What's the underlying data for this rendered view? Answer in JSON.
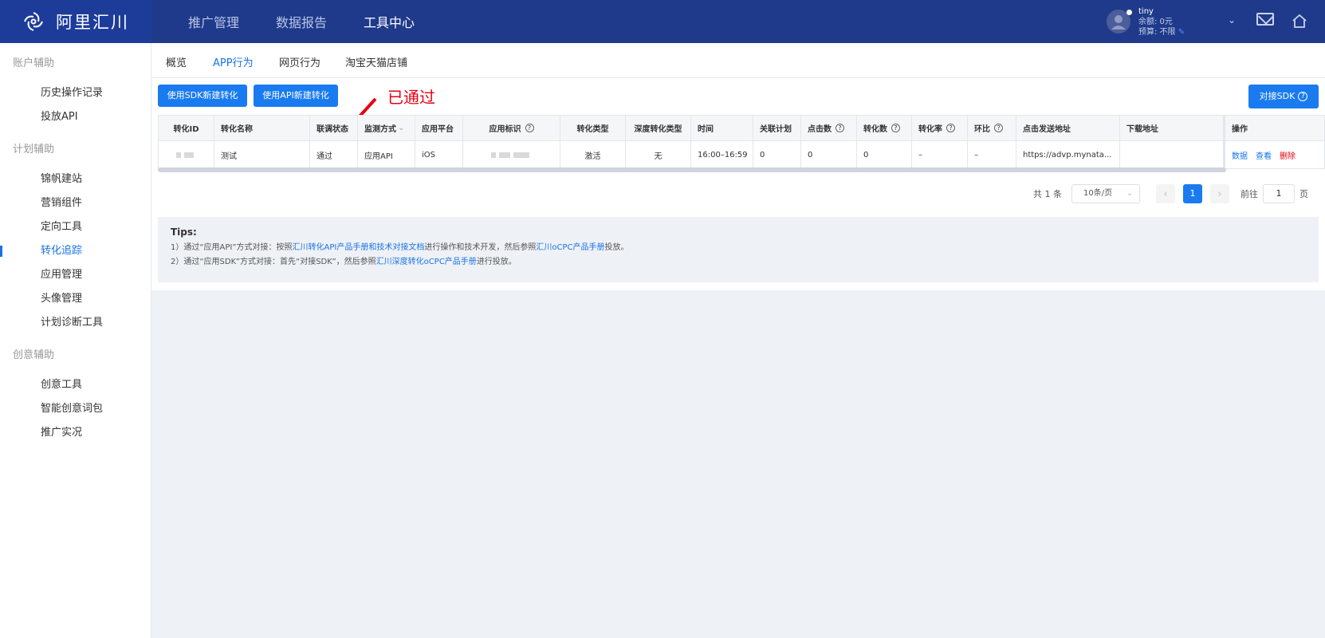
{
  "app": {
    "brand": "阿里汇川"
  },
  "topnav": [
    {
      "label": "推广管理",
      "active": false
    },
    {
      "label": "数据报告",
      "active": false
    },
    {
      "label": "工具中心",
      "active": true
    }
  ],
  "user": {
    "name": "tiny",
    "balance": "余额: 0元",
    "budget": "预算: 不限"
  },
  "sidebar": {
    "groups": [
      {
        "title": "账户辅助",
        "items": [
          "历史操作记录",
          "投放API"
        ]
      },
      {
        "title": "计划辅助",
        "items": [
          "锦帆建站",
          "营销组件",
          "定向工具",
          "转化追踪",
          "应用管理",
          "头像管理",
          "计划诊断工具"
        ]
      },
      {
        "title": "创意辅助",
        "items": [
          "创意工具",
          "智能创意词包",
          "推广实况"
        ]
      }
    ],
    "active": "转化追踪"
  },
  "tabs": [
    "概览",
    "APP行为",
    "网页行为",
    "淘宝天猫店铺"
  ],
  "buttons": {
    "sdk_new": "使用SDK新建转化",
    "api_new": "使用API新建转化",
    "connect_sdk": "对接SDK"
  },
  "annotation": "已通过",
  "table": {
    "headers": [
      "转化ID",
      "转化名称",
      "联调状态",
      "监测方式",
      "应用平台",
      "应用标识",
      "转化类型",
      "深度转化类型",
      "时间",
      "关联计划",
      "点击数",
      "转化数",
      "转化率",
      "环比",
      "点击发送地址",
      "下载地址",
      "操作"
    ],
    "row": {
      "name": "测试",
      "status": "通过",
      "monitor": "应用API",
      "platform": "iOS",
      "conv_type": "激活",
      "deep_type": "无",
      "time": "16:00–16:59",
      "plans": "0",
      "clicks": "0",
      "convs": "0",
      "rate": "–",
      "mom": "–",
      "click_url": "https://advp.mynata...",
      "download_url": ""
    },
    "actions": [
      "数据",
      "查看",
      "删除"
    ]
  },
  "pager": {
    "total": "共 1 条",
    "page_size": "10条/页",
    "current": "1",
    "goto": "前往",
    "goto_value": "1",
    "page_unit": "页"
  },
  "tips": {
    "title": "Tips:",
    "line1": {
      "a": "1）通过“应用API”方式对接：按照",
      "link1": "汇川转化API产品手册和技术对接文档",
      "b": "进行操作和技术开发，然后参照",
      "link2": "汇川oCPC产品手册",
      "c": "投放。"
    },
    "line2": {
      "a": "2）通过“应用SDK”方式对接：首先“对接SDK”，然后参照",
      "link1": "汇川深度转化oCPC产品手册",
      "b": "进行投放。"
    }
  }
}
